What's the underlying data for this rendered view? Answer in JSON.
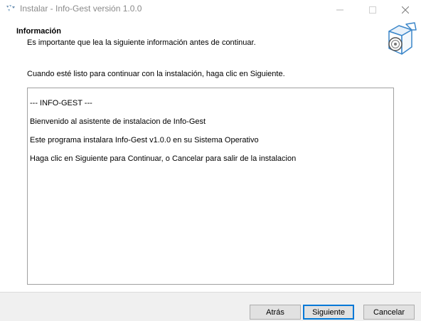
{
  "window": {
    "title": "Instalar - Info-Gest versión 1.0.0",
    "controls": [
      "minimize",
      "maximize",
      "close"
    ]
  },
  "header": {
    "title": "Información",
    "subtitle": "Es importante que lea la siguiente información antes de continuar.",
    "icon": "setup-box-icon"
  },
  "content": {
    "ready_text": "Cuando esté listo para continuar con la instalación, haga clic en Siguiente.",
    "memo_lines": [
      "--- INFO-GEST ---",
      "Bienvenido al asistente de instalacion de Info-Gest",
      "Este programa instalara Info-Gest v1.0.0 en su Sistema Operativo",
      "Haga clic en Siguiente para Continuar, o Cancelar para salir de la instalacion"
    ]
  },
  "buttons": {
    "back": "Atrás",
    "next": "Siguiente",
    "cancel": "Cancelar"
  }
}
